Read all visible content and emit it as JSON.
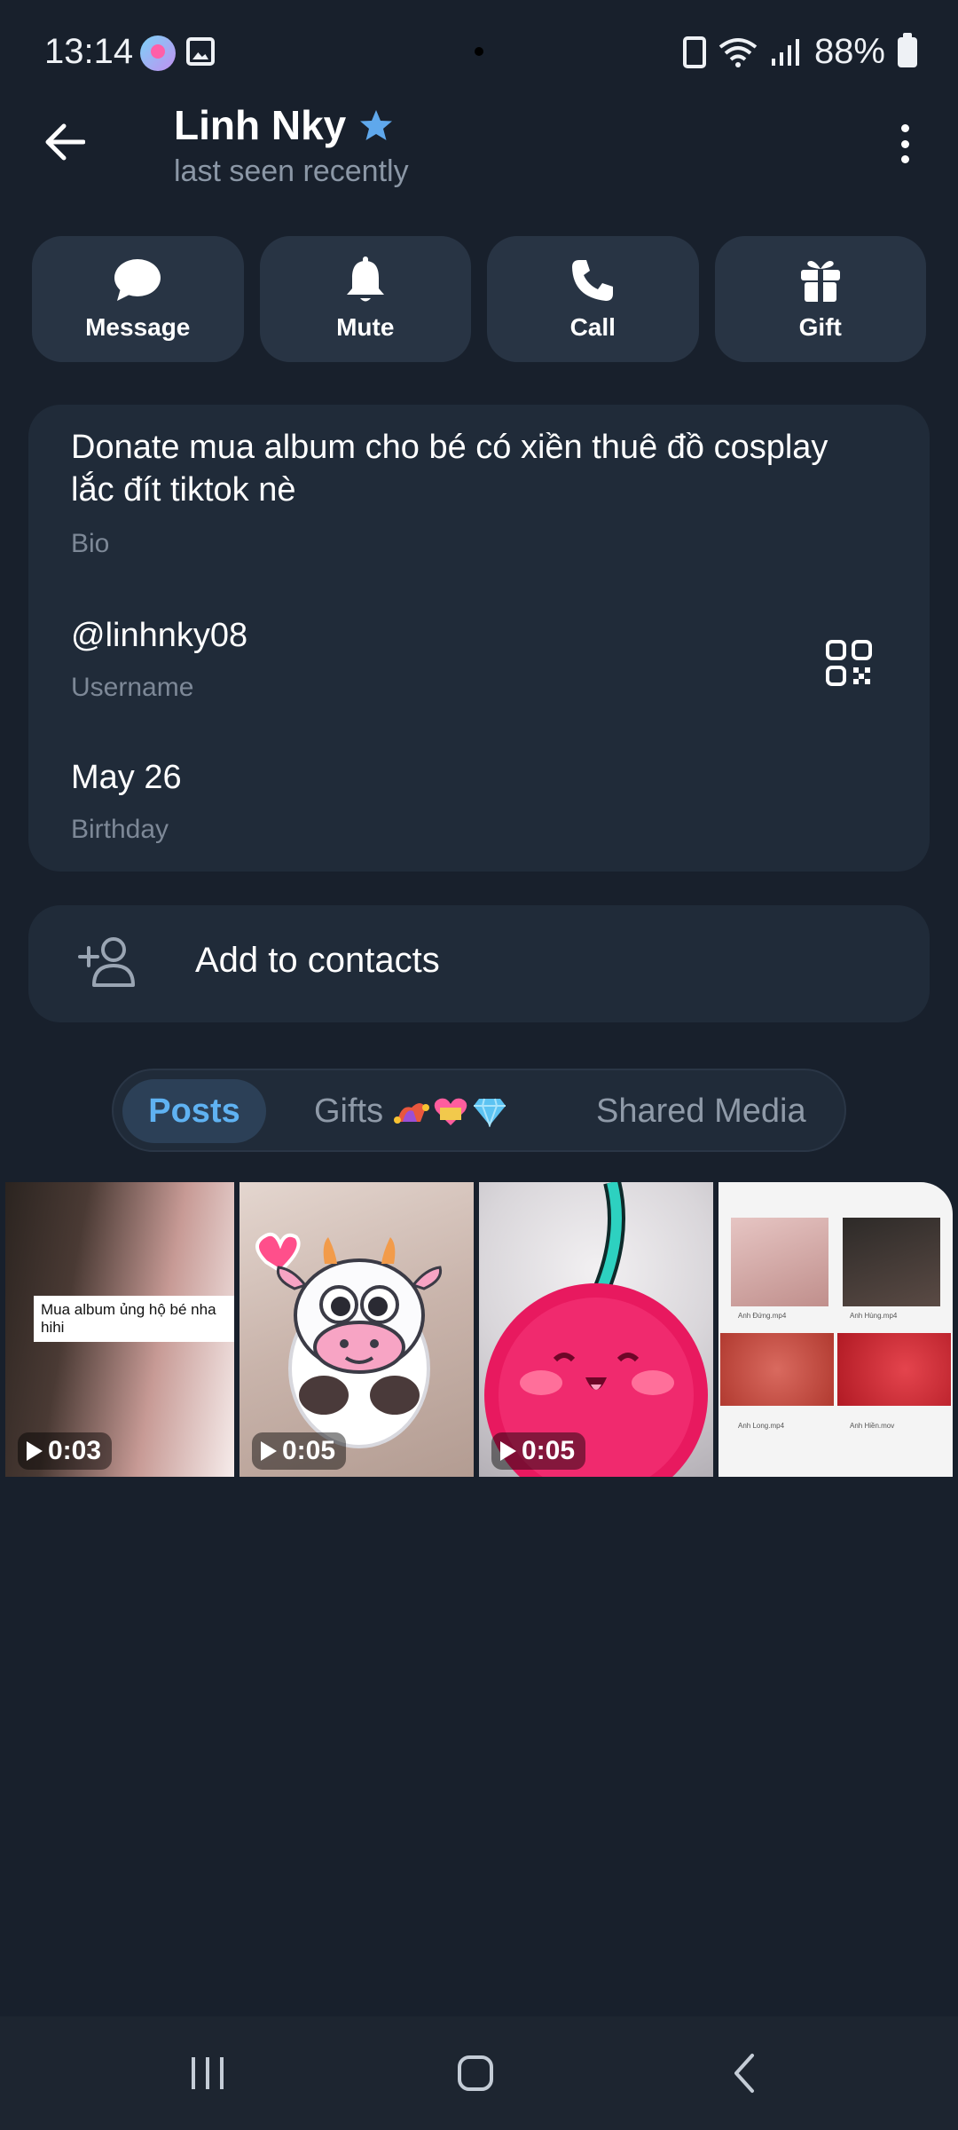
{
  "status_bar": {
    "time": "13:14",
    "battery_percent": "88%",
    "icons": [
      "notification-app-icon",
      "gallery-icon",
      "battery-saver-icon",
      "wifi-icon",
      "signal-icon",
      "battery-icon"
    ]
  },
  "header": {
    "name": "Linh Nky",
    "status": "last seen recently",
    "verified_icon": "star-icon"
  },
  "actions": [
    {
      "label": "Message",
      "icon": "chat-bubble-icon"
    },
    {
      "label": "Mute",
      "icon": "bell-icon"
    },
    {
      "label": "Call",
      "icon": "phone-icon"
    },
    {
      "label": "Gift",
      "icon": "gift-icon"
    }
  ],
  "info": {
    "bio_value": "Donate mua album cho bé có xiền thuê đồ cosplay lắc đít tiktok nè",
    "bio_label": "Bio",
    "username_value": "@linhnky08",
    "username_label": "Username",
    "birthday_value": "May 26",
    "birthday_label": "Birthday"
  },
  "add_contact": {
    "label": "Add to contacts"
  },
  "tabs": {
    "posts": "Posts",
    "gifts": "Gifts",
    "shared_media": "Shared Media",
    "active": "Posts"
  },
  "media": [
    {
      "duration": "0:03",
      "caption": "Mua album ủng hộ bé nha hihi"
    },
    {
      "duration": "0:05"
    },
    {
      "duration": "0:05"
    },
    {
      "thumb_labels": [
        "Anh Đứng.mp4",
        "Anh Hùng.mp4",
        "Anh Long.mp4",
        "Anh Hiền.mov"
      ]
    }
  ],
  "colors": {
    "background": "#18202c",
    "card": "#202b39",
    "button": "#283444",
    "accent": "#5fb2f2",
    "muted_text": "#7d8897"
  }
}
